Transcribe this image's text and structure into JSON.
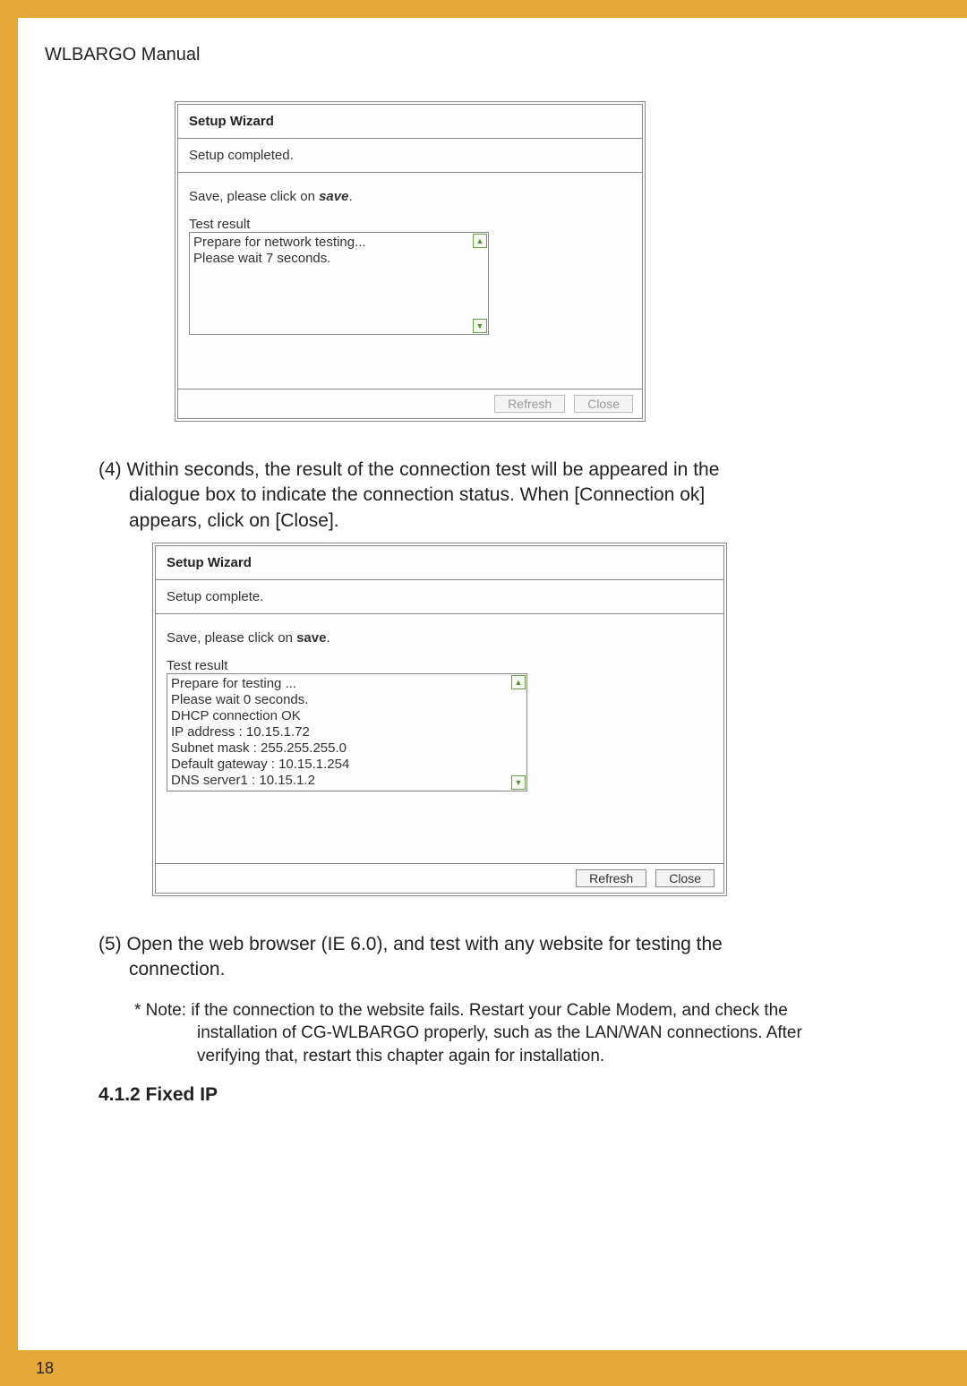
{
  "manual_title": "WLBARGO Manual",
  "page_number": "18",
  "fig1": {
    "title": "Setup Wizard",
    "status": "Setup completed.",
    "save_prefix": "Save, please click on ",
    "save_bold": "save",
    "save_suffix": ".",
    "test_label": "Test result",
    "test_text": "Prepare for network testing...\nPlease wait  7  seconds.",
    "refresh": "Refresh",
    "close": "Close"
  },
  "para4_lead": "(4) ",
  "para4_line1": "Within seconds, the result of the connection test will be appeared in the",
  "para4_line2": "dialogue box to indicate the connection status. When [Connection ok]",
  "para4_line3": "appears, click on [Close].",
  "fig2": {
    "title": "Setup Wizard",
    "status": "Setup complete.",
    "save_prefix": "Save, please click on ",
    "save_bold": "save",
    "save_suffix": ".",
    "test_label": "Test result",
    "test_text": "Prepare for testing ...\nPlease wait 0 seconds.\nDHCP connection OK\nIP address : 10.15.1.72\nSubnet mask : 255.255.255.0\nDefault gateway  : 10.15.1.254\nDNS server1 : 10.15.1.2",
    "refresh": "Refresh",
    "close": "Close"
  },
  "para5_lead": "(5) ",
  "para5_line1": "Open the web browser (IE 6.0), and test with any website for testing the",
  "para5_line2": "connection.",
  "note_lead": "* Note: ",
  "note_line1": "if the connection to the website fails. Restart your Cable Modem, and check the",
  "note_line2": "installation of CG-WLBARGO properly, such as the LAN/WAN connections. After",
  "note_line3": "verifying that, restart this chapter again for installation.",
  "section_heading": "4.1.2 Fixed IP"
}
